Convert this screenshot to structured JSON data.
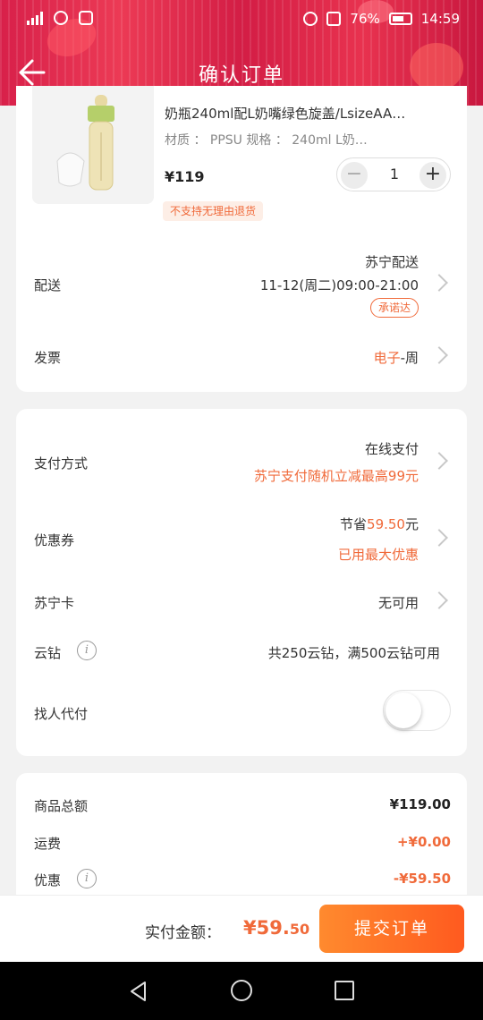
{
  "status_bar": {
    "network": "4G",
    "battery": "76%",
    "time": "14:59"
  },
  "header": {
    "title": "确认订单"
  },
  "product": {
    "title": "奶瓶240ml配L奶嘴绿色旋盖/LsizeAA…",
    "spec": "材质 ： PPSU   规格 ： 240ml L奶…",
    "price": "¥119",
    "quantity": "1",
    "return_policy": "不支持无理由退货"
  },
  "delivery": {
    "label": "配送",
    "provider": "苏宁配送",
    "time": "11-12(周二)09:00-21:00",
    "badge": "承诺达"
  },
  "invoice": {
    "label": "发票",
    "type": "电子",
    "detail": "-周"
  },
  "payment": {
    "label": "支付方式",
    "method": "在线支付",
    "promo": "苏宁支付随机立减最高99元"
  },
  "coupon": {
    "label": "优惠券",
    "save_prefix": "节省",
    "save_amount": "59.50",
    "save_suffix": "元",
    "status": "已用最大优惠"
  },
  "suning_card": {
    "label": "苏宁卡",
    "value": "无可用"
  },
  "yunzuan": {
    "label": "云钻",
    "value": "共250云钻，满500云钻可用"
  },
  "proxy_pay": {
    "label": "找人代付",
    "enabled": false
  },
  "summary": {
    "goods_label": "商品总额",
    "goods_value": "¥119.00",
    "shipping_label": "运费",
    "shipping_value": "+¥0.00",
    "discount_label": "优惠",
    "discount_value": "-¥59.50"
  },
  "bottom": {
    "pay_label": "实付金额：",
    "pay_amount_main": "¥59.",
    "pay_amount_cents": "50",
    "submit_label": "提交订单"
  },
  "colors": {
    "accent": "#f06a3a",
    "header": "#d8204a",
    "button": "#ff6a24"
  }
}
